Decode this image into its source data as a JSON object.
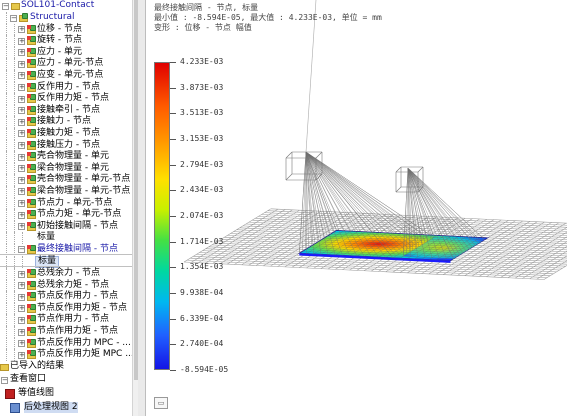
{
  "tree": {
    "root_label": "SOL101-Contact",
    "structural_label": "Structural",
    "items": [
      {
        "label": "位移 - 节点"
      },
      {
        "label": "旋转 - 节点"
      },
      {
        "label": "应力 - 单元"
      },
      {
        "label": "应力 - 单元-节点"
      },
      {
        "label": "应变 - 单元-节点"
      },
      {
        "label": "反作用力 - 节点"
      },
      {
        "label": "反作用力矩 - 节点"
      },
      {
        "label": "接触牵引 - 节点"
      },
      {
        "label": "接触力 - 节点"
      },
      {
        "label": "接触力矩 - 节点"
      },
      {
        "label": "接触压力 - 节点"
      },
      {
        "label": "壳合物理量 - 单元"
      },
      {
        "label": "梁合物理量 - 单元"
      },
      {
        "label": "壳合物理量 - 单元-节点"
      },
      {
        "label": "梁合物理量 - 单元-节点"
      },
      {
        "label": "节点力 - 单元-节点"
      },
      {
        "label": "节点力矩 - 单元-节点"
      },
      {
        "label": "初始接触间隔 - 节点"
      }
    ],
    "initial_gap_child": "标量",
    "selected_item": "最终接触间隔 - 节点",
    "selected_child": "标量",
    "items_after": [
      {
        "label": "总残余力 - 节点"
      },
      {
        "label": "总残余力矩 - 节点"
      },
      {
        "label": "节点反作用力 - 节点"
      },
      {
        "label": "节点反作用力矩 - 节点"
      },
      {
        "label": "节点作用力 - 节点"
      },
      {
        "label": "节点作用力矩 - 节点"
      },
      {
        "label": "节点反作用力 MPC - ..."
      },
      {
        "label": "节点反作用力矩 MPC ..."
      }
    ],
    "imported_results": "已导入的结果",
    "viewer_window": "查看窗口",
    "contour_plot": "等值线图",
    "last_partial": "后处理视图 2"
  },
  "viewport": {
    "header_line1": "最终接触间隔 - 节点, 标量",
    "header_line2": "最小值 : -8.594E-05, 最大值 : 4.233E-03, 单位 = mm",
    "header_line3": "变形 : 位移 - 节点 幅值",
    "legend_values": [
      "4.233E-03",
      "3.873E-03",
      "3.513E-03",
      "3.153E-03",
      "2.794E-03",
      "2.434E-03",
      "2.074E-03",
      "1.714E-03",
      "1.354E-03",
      "9.938E-04",
      "6.339E-04",
      "2.740E-04",
      "-8.594E-05"
    ]
  },
  "colors": {
    "legend_top": "#e00000",
    "legend_bottom": "#1414e6",
    "mesh": "#9a9a9a",
    "wire": "#6e6e6e"
  },
  "icons": [
    "expand-plus-icon",
    "collapse-minus-icon",
    "result-folder-icon",
    "structural-node-icon",
    "viewer-window-icon",
    "contour-plot-icon"
  ]
}
